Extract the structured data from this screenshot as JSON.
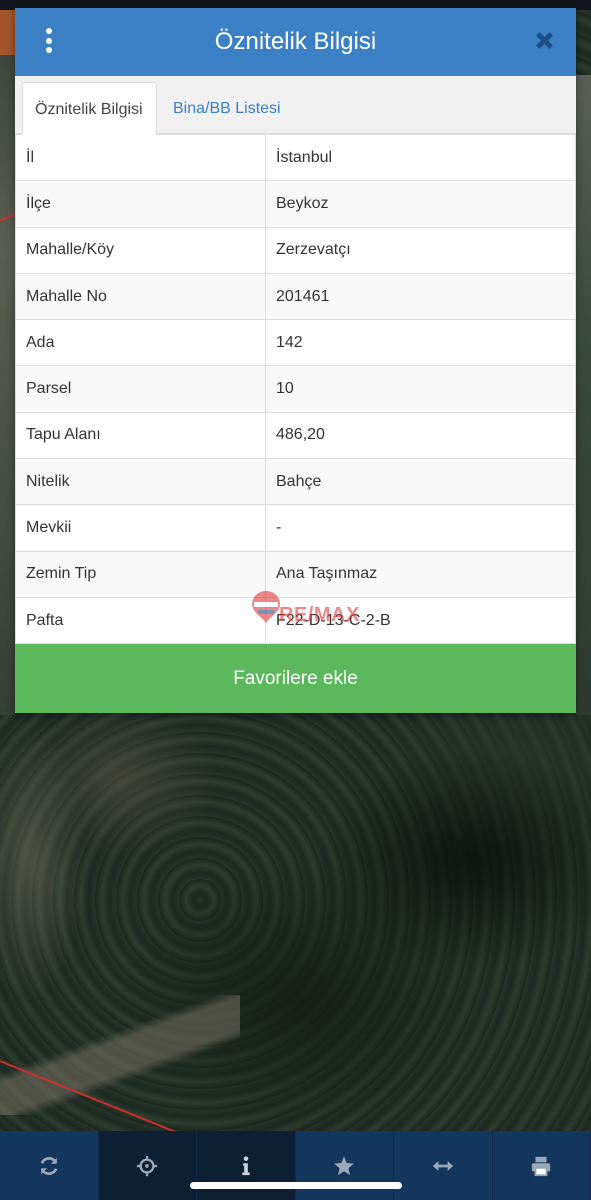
{
  "header": {
    "title": "Öznitelik Bilgisi"
  },
  "tabs": [
    {
      "label": "Öznitelik Bilgisi",
      "active": true
    },
    {
      "label": "Bina/BB Listesi",
      "active": false
    }
  ],
  "attributes": [
    {
      "key": "İl",
      "value": "İstanbul"
    },
    {
      "key": "İlçe",
      "value": "Beykoz"
    },
    {
      "key": "Mahalle/Köy",
      "value": "Zerzevatçı"
    },
    {
      "key": "Mahalle No",
      "value": "201461"
    },
    {
      "key": "Ada",
      "value": "142"
    },
    {
      "key": "Parsel",
      "value": "10"
    },
    {
      "key": "Tapu Alanı",
      "value": "486,20"
    },
    {
      "key": "Nitelik",
      "value": "Bahçe"
    },
    {
      "key": "Mevkii",
      "value": "-"
    },
    {
      "key": "Zemin Tip",
      "value": "Ana Taşınmaz"
    },
    {
      "key": "Pafta",
      "value": "F22-D-13-C-2-B"
    }
  ],
  "favorite_button": {
    "label": "Favorilere ekle"
  },
  "watermark": {
    "text": "RE/MAX",
    "balloon_text": "RE/MAX"
  },
  "toolbar": {
    "items": [
      {
        "icon": "refresh-icon",
        "active": false
      },
      {
        "icon": "crosshairs-icon",
        "active": true
      },
      {
        "icon": "info-icon",
        "active": true
      },
      {
        "icon": "star-icon",
        "active": false
      },
      {
        "icon": "arrows-horizontal-icon",
        "active": false
      },
      {
        "icon": "print-icon",
        "active": false
      }
    ]
  },
  "colors": {
    "header": "#3b7fc4",
    "accent_link": "#3b7fc4",
    "button_green": "#5cb85c",
    "toolbar": "#15365c",
    "toolbar_active": "#0d1f33",
    "close_icon": "#1f4f86"
  }
}
